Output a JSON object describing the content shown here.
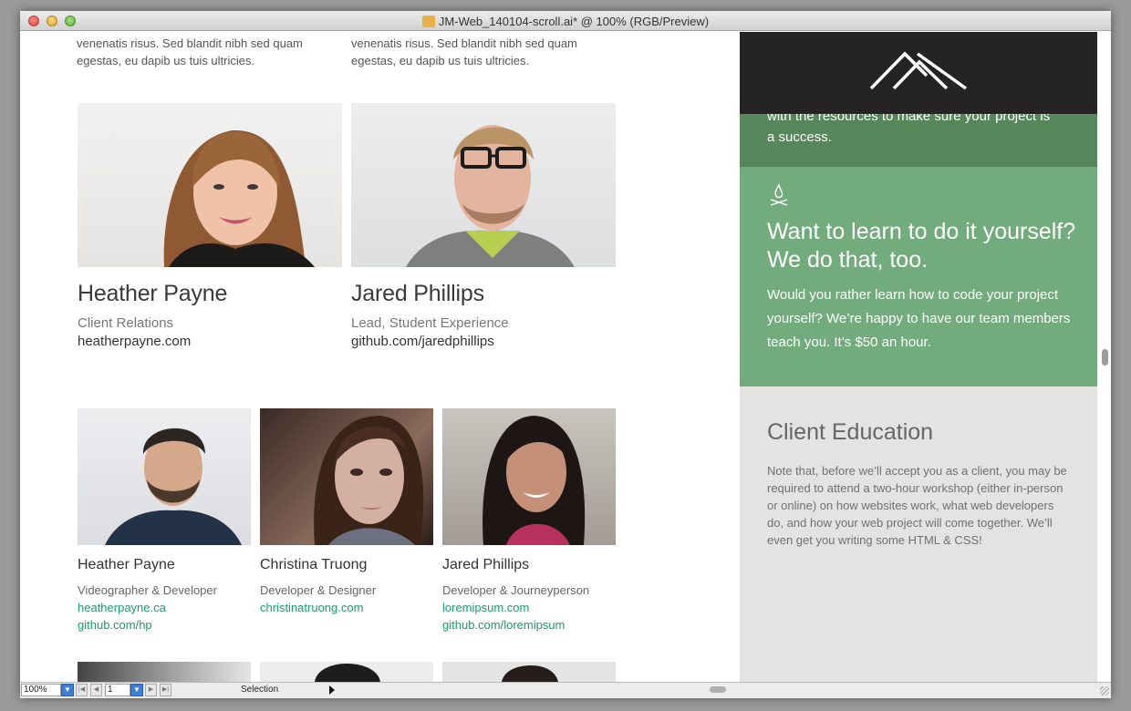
{
  "window": {
    "title": "JM-Web_140104-scroll.ai* @ 100% (RGB/Preview)"
  },
  "top_lorem": {
    "left": "venenatis risus. Sed blandit nibh sed quam egestas, eu dapib us tuis ultricies.",
    "right": "venenatis risus. Sed blandit nibh sed quam egestas, eu dapib us tuis ultricies."
  },
  "featured": [
    {
      "name": "Heather Payne",
      "role": "Client Relations",
      "link": "heatherpayne.com"
    },
    {
      "name": "Jared Phillips",
      "role": "Lead, Student Experience",
      "link": "github.com/jaredphillips"
    }
  ],
  "team": [
    {
      "name": "Heather Payne",
      "role": "Videographer & Developer",
      "link1": "heatherpayne.ca",
      "link2": "github.com/hp"
    },
    {
      "name": "Christina Truong",
      "role": "Developer & Designer",
      "link1": "christinatruong.com",
      "link2": ""
    },
    {
      "name": "Jared Phillips",
      "role": "Developer & Journeyperson",
      "link1": "loremipsum.com",
      "link2": "github.com/loremipsum"
    }
  ],
  "sidebar": {
    "partial_text_1": "with the resources to make sure your project is",
    "partial_text_2": "a success.",
    "diy_heading": "Want to learn to do it yourself? We do that, too.",
    "diy_body": "Would you rather learn how to code your project yourself? We’re happy to have our team members teach you. It’s $50 an hour.",
    "education_heading": "Client Education",
    "education_body": "Note that, before we’ll accept you as a client, you may be required to attend a two-hour workshop (either in-person or online) on how websites work, what web developers do, and how your web project will come together. We’ll even get you writing some HTML & CSS!"
  },
  "statusbar": {
    "zoom": "100%",
    "artboard": "1",
    "tool": "Selection"
  },
  "colors": {
    "accent_link": "#1f9a6b",
    "logo_band": "#252323",
    "green_dark": "#55875b",
    "green_light": "#72ab7c",
    "sidebar_gray": "#e3e3e2"
  },
  "icons": {
    "logo": "mountains-logo-icon",
    "campfire": "campfire-icon"
  }
}
